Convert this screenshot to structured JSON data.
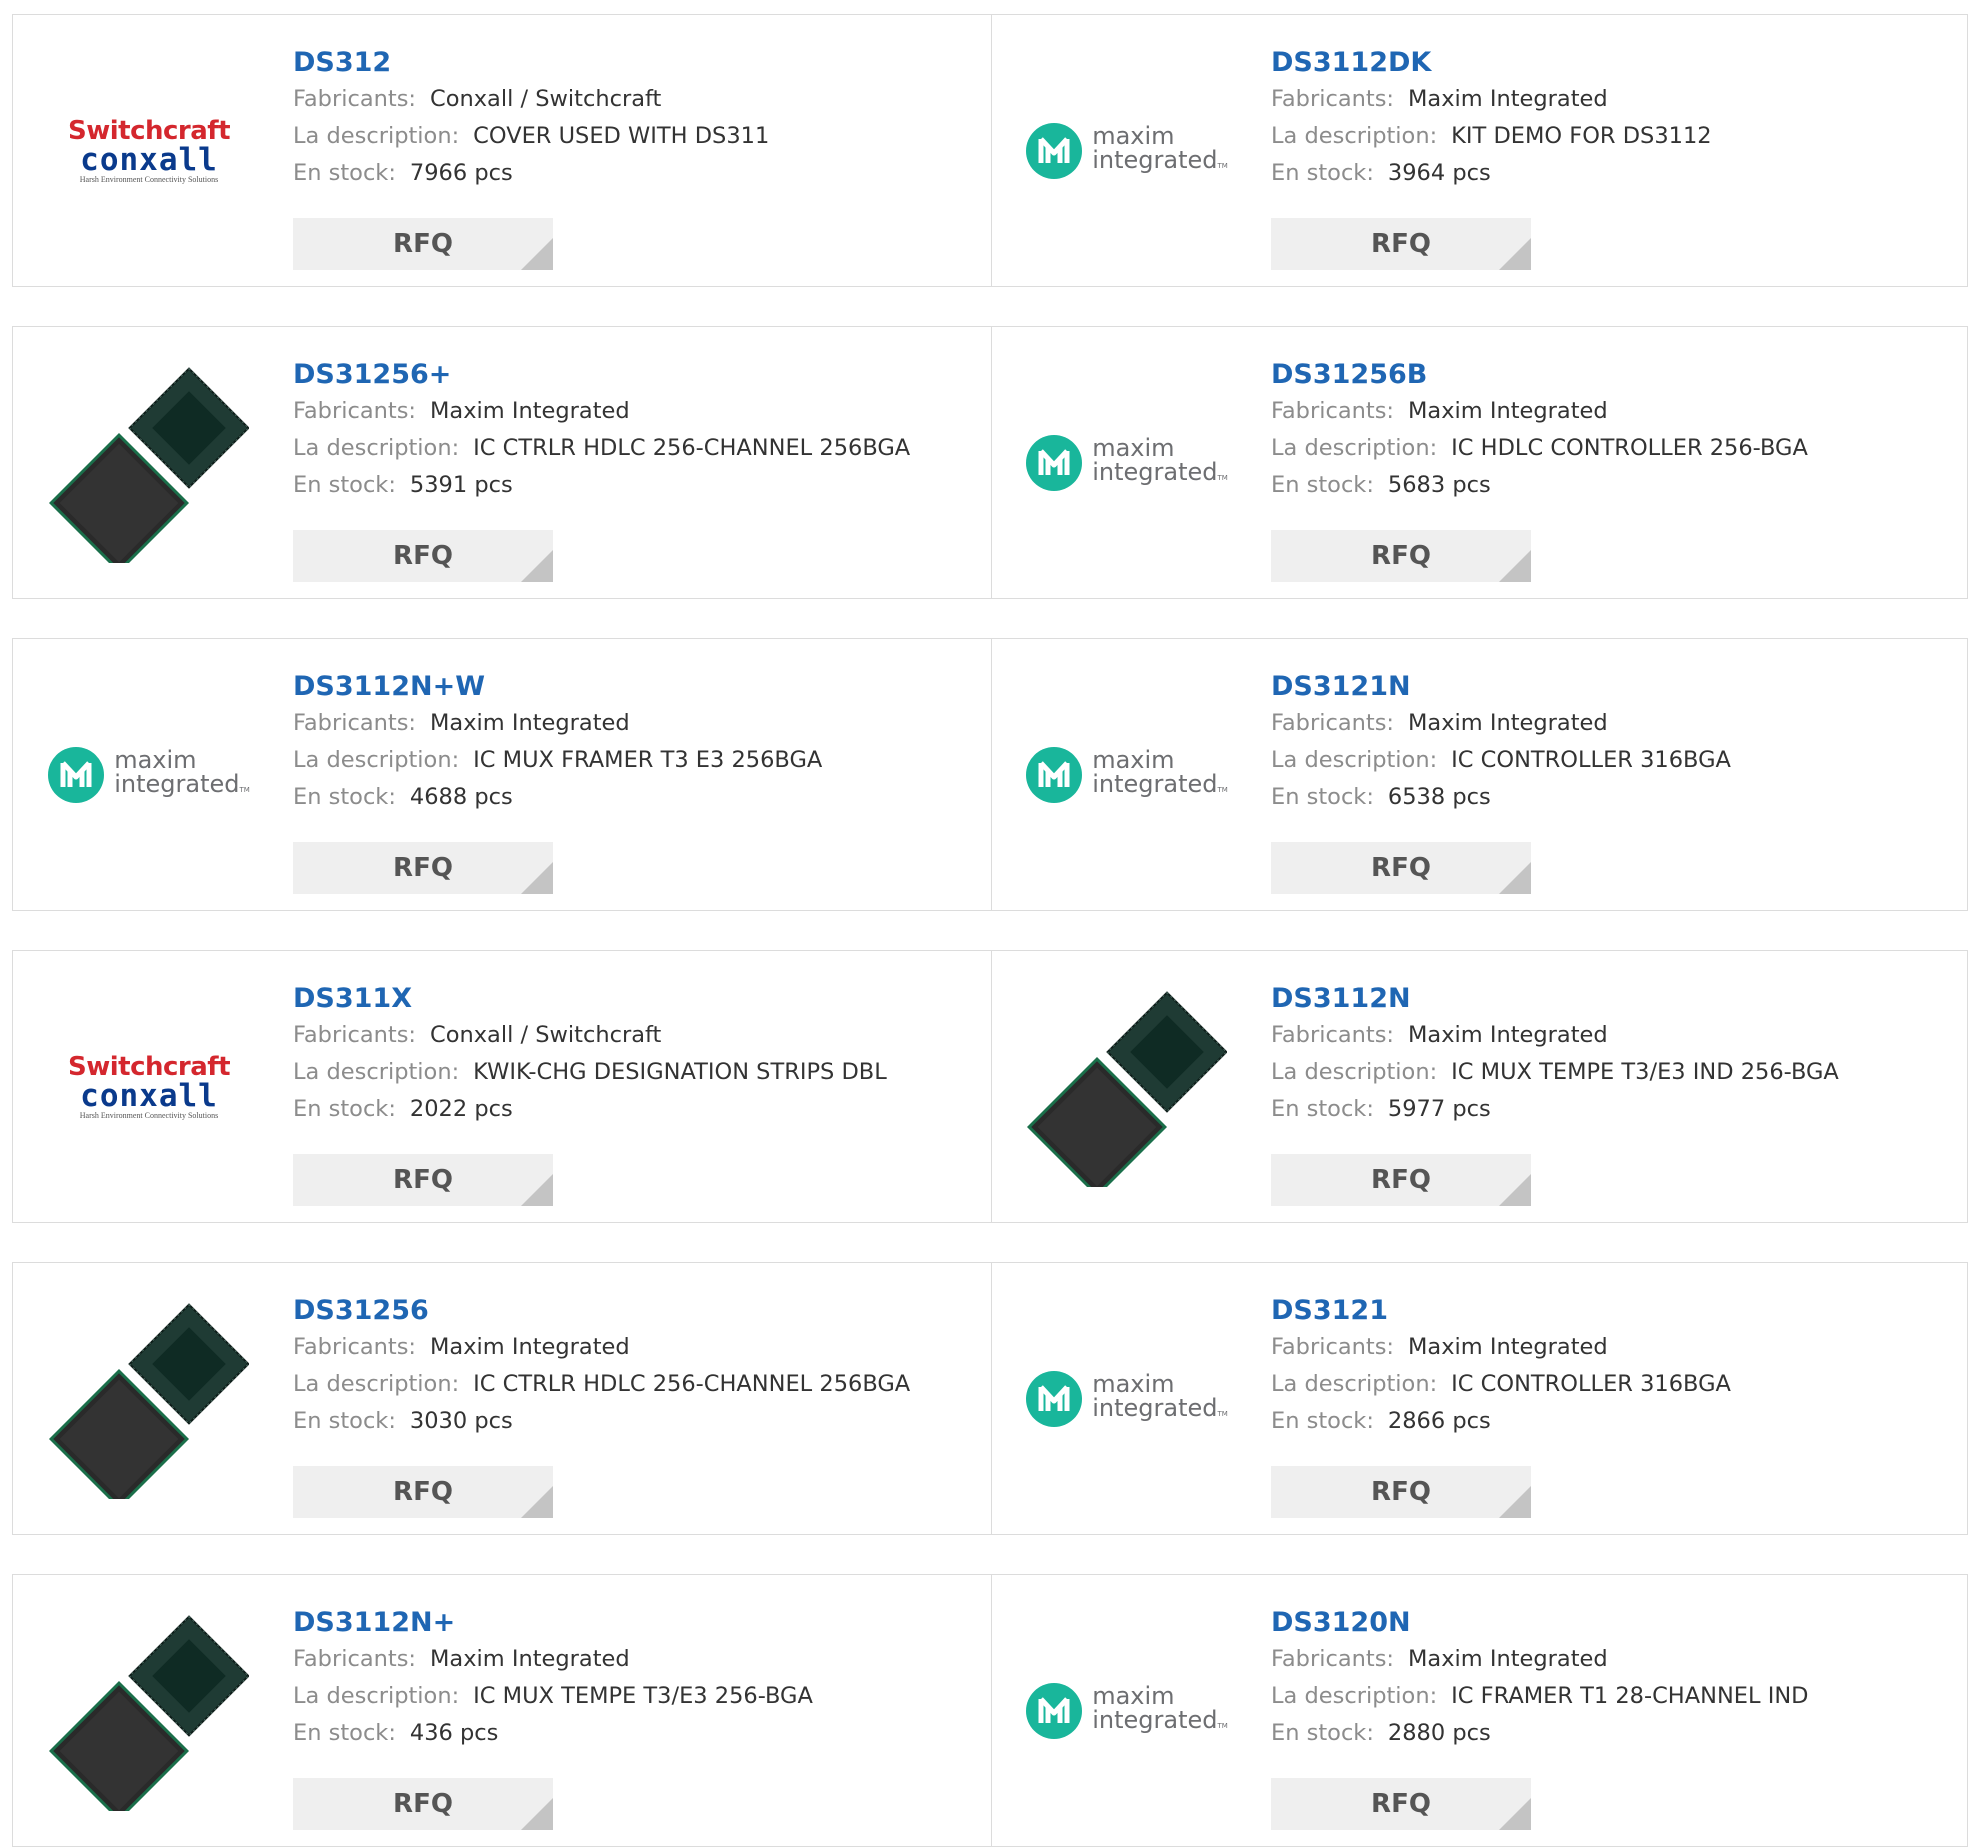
{
  "labels": {
    "manufacturer": "Fabricants:",
    "description": "La description:",
    "stock": "En stock:",
    "rfq": "RFQ"
  },
  "logos": {
    "switchcraft": {
      "line1": "Switchcraft",
      "line2": "conxall",
      "line3": "Harsh Environment Connectivity Solutions"
    },
    "maxim": {
      "line1": "maxim",
      "line2": "integrated",
      "tm": "TM"
    }
  },
  "products": [
    {
      "part": "DS312",
      "manufacturer": "Conxall / Switchcraft",
      "description": "COVER USED WITH DS311",
      "stock": "7966 pcs",
      "image": "switchcraft-logo"
    },
    {
      "part": "DS3112DK",
      "manufacturer": "Maxim Integrated",
      "description": "KIT DEMO FOR DS3112",
      "stock": "3964 pcs",
      "image": "maxim-logo"
    },
    {
      "part": "DS31256+",
      "manufacturer": "Maxim Integrated",
      "description": "IC CTRLR HDLC 256-CHANNEL 256BGA",
      "stock": "5391 pcs",
      "image": "bga-chip-photo"
    },
    {
      "part": "DS31256B",
      "manufacturer": "Maxim Integrated",
      "description": "IC HDLC CONTROLLER 256-BGA",
      "stock": "5683 pcs",
      "image": "maxim-logo"
    },
    {
      "part": "DS3112N+W",
      "manufacturer": "Maxim Integrated",
      "description": "IC MUX FRAMER T3 E3 256BGA",
      "stock": "4688 pcs",
      "image": "maxim-logo"
    },
    {
      "part": "DS3121N",
      "manufacturer": "Maxim Integrated",
      "description": "IC CONTROLLER 316BGA",
      "stock": "6538 pcs",
      "image": "maxim-logo"
    },
    {
      "part": "DS311X",
      "manufacturer": "Conxall / Switchcraft",
      "description": "KWIK-CHG DESIGNATION STRIPS DBL",
      "stock": "2022 pcs",
      "image": "switchcraft-logo"
    },
    {
      "part": "DS3112N",
      "manufacturer": "Maxim Integrated",
      "description": "IC MUX TEMPE T3/E3 IND 256-BGA",
      "stock": "5977 pcs",
      "image": "bga-chip-photo"
    },
    {
      "part": "DS31256",
      "manufacturer": "Maxim Integrated",
      "description": "IC CTRLR HDLC 256-CHANNEL 256BGA",
      "stock": "3030 pcs",
      "image": "bga-chip-photo"
    },
    {
      "part": "DS3121",
      "manufacturer": "Maxim Integrated",
      "description": "IC CONTROLLER 316BGA",
      "stock": "2866 pcs",
      "image": "maxim-logo"
    },
    {
      "part": "DS3112N+",
      "manufacturer": "Maxim Integrated",
      "description": "IC MUX TEMPE T3/E3 256-BGA",
      "stock": "436 pcs",
      "image": "bga-chip-photo"
    },
    {
      "part": "DS3120N",
      "manufacturer": "Maxim Integrated",
      "description": "IC FRAMER T1 28-CHANNEL IND",
      "stock": "2880 pcs",
      "image": "maxim-logo"
    }
  ],
  "colors": {
    "part_link": "#1f66b3",
    "label": "#8c8c8c",
    "value": "#333333",
    "rfq_bg": "#efefef",
    "border": "#dcdcdc",
    "maxim_teal": "#19b69b",
    "switchcraft_red": "#d4272e",
    "conxall_blue": "#0a3a8c"
  }
}
